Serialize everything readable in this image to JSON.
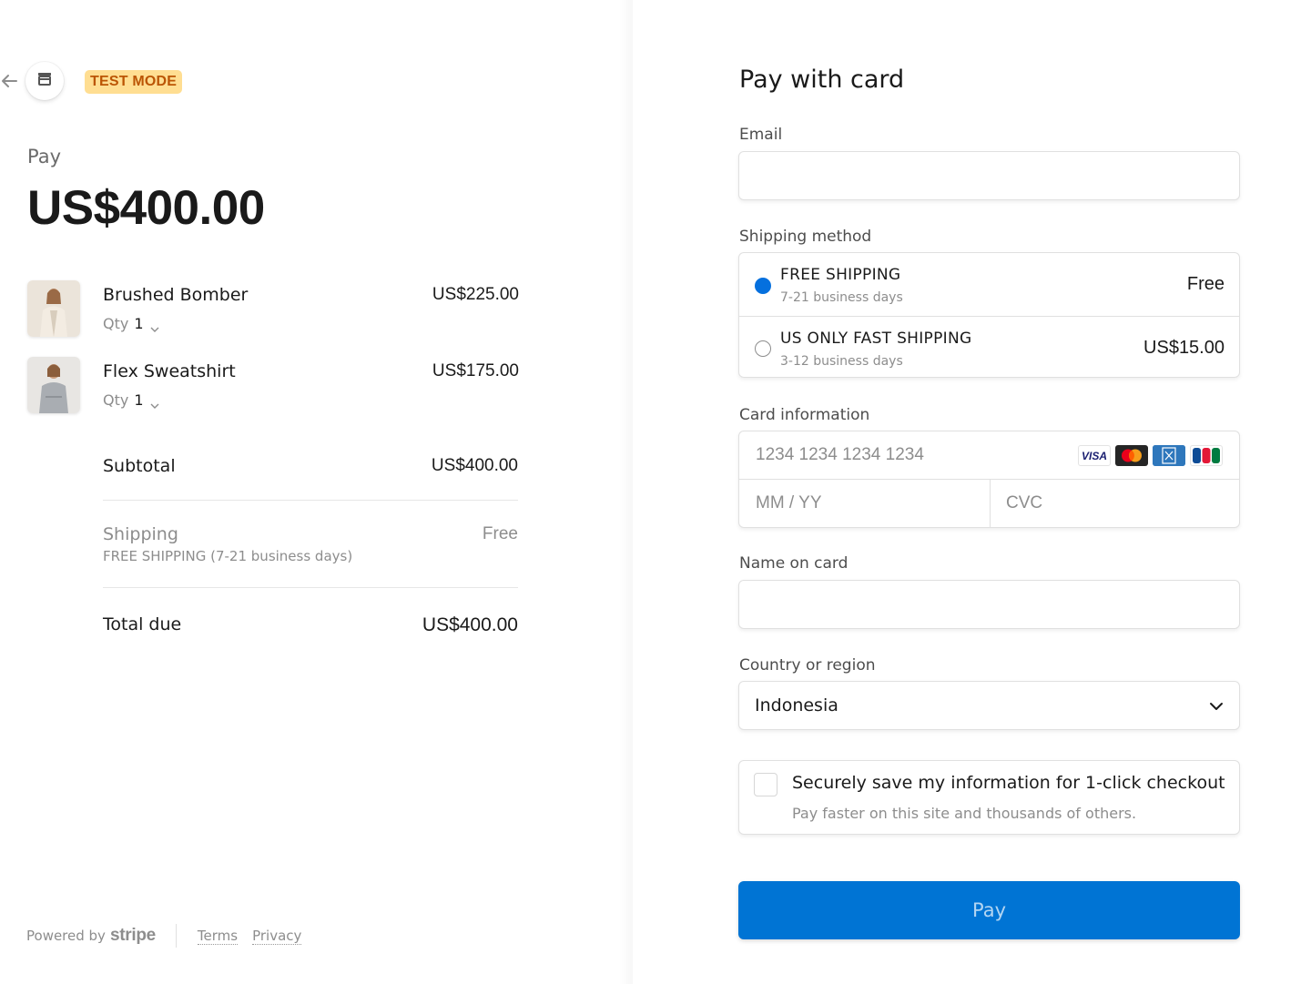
{
  "header": {
    "test_badge": "TEST MODE"
  },
  "summary": {
    "pay_label": "Pay",
    "amount": "US$400.00",
    "items": [
      {
        "name": "Brushed Bomber",
        "qty_label": "Qty",
        "qty": "1",
        "price": "US$225.00"
      },
      {
        "name": "Flex Sweatshirt",
        "qty_label": "Qty",
        "qty": "1",
        "price": "US$175.00"
      }
    ],
    "subtotal_label": "Subtotal",
    "subtotal_value": "US$400.00",
    "shipping_label": "Shipping",
    "shipping_detail": "FREE SHIPPING (7-21 business days)",
    "shipping_value": "Free",
    "total_label": "Total due",
    "total_value": "US$400.00"
  },
  "footer": {
    "powered_by": "Powered by",
    "brand": "stripe",
    "terms": "Terms",
    "privacy": "Privacy"
  },
  "form": {
    "title": "Pay with card",
    "email_label": "Email",
    "email_value": "",
    "shipping_method_label": "Shipping method",
    "shipping_options": [
      {
        "name": "FREE SHIPPING",
        "days": "7-21 business days",
        "price": "Free",
        "selected": true
      },
      {
        "name": "US ONLY FAST SHIPPING",
        "days": "3-12 business days",
        "price": "US$15.00",
        "selected": false
      }
    ],
    "card_label": "Card information",
    "card_number_placeholder": "1234 1234 1234 1234",
    "card_expiry_placeholder": "MM / YY",
    "card_cvc_placeholder": "CVC",
    "card_brands": [
      "visa-icon",
      "mastercard-icon",
      "amex-icon",
      "jcb-icon"
    ],
    "name_label": "Name on card",
    "name_value": "",
    "country_label": "Country or region",
    "country_value": "Indonesia",
    "save_title": "Securely save my information for 1-click checkout",
    "save_subtitle": "Pay faster on this site and thousands of others.",
    "save_checked": false,
    "pay_button": "Pay"
  },
  "colors": {
    "accent": "#0570de",
    "pay_button": "#0074d4",
    "badge_bg": "#ffde92",
    "badge_text": "#bb5504"
  }
}
